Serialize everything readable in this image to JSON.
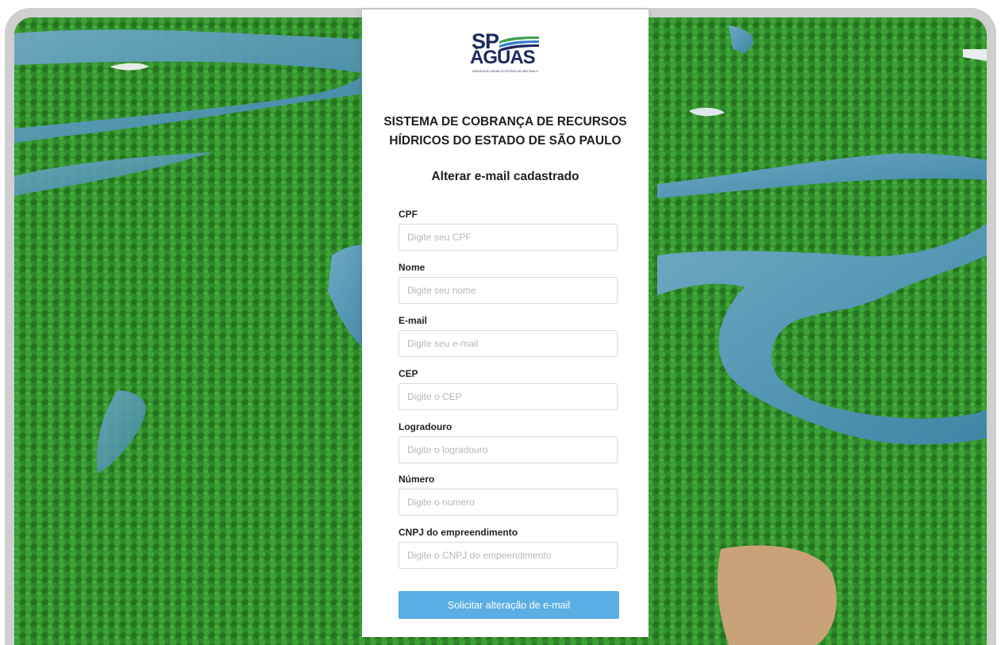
{
  "logo": {
    "line1": "SP",
    "line2": "ÁGUAS",
    "tagline": "AGÊNCIA DE ÁGUAS DO ESTADO DE SÃO PAULO"
  },
  "header": {
    "system_title_line1": "SISTEMA DE COBRANÇA DE RECURSOS",
    "system_title_line2": "HÍDRICOS DO ESTADO DE SÃO PAULO",
    "form_title": "Alterar e-mail cadastrado"
  },
  "form": {
    "fields": [
      {
        "label": "CPF",
        "placeholder": "Digite seu CPF",
        "value": ""
      },
      {
        "label": "Nome",
        "placeholder": "Digite seu nome",
        "value": ""
      },
      {
        "label": "E-mail",
        "placeholder": "Digite seu e-mail",
        "value": ""
      },
      {
        "label": "CEP",
        "placeholder": "Digite o CEP",
        "value": ""
      },
      {
        "label": "Logradouro",
        "placeholder": "Digite o logradouro",
        "value": ""
      },
      {
        "label": "Número",
        "placeholder": "Digite o numero",
        "value": ""
      },
      {
        "label": "CNPJ do empreendimento",
        "placeholder": "Digite o CNPJ do empeendimento",
        "value": ""
      }
    ],
    "submit_label": "Solicitar alteração de e-mail"
  },
  "colors": {
    "button": "#5aaee3",
    "logo_navy": "#1b2a5e",
    "logo_green": "#3fa34d",
    "logo_blue": "#3a7fd0"
  },
  "icons": {
    "background": "mangrove-river-aerial-photo",
    "logo_mark": "water-waves-icon"
  }
}
